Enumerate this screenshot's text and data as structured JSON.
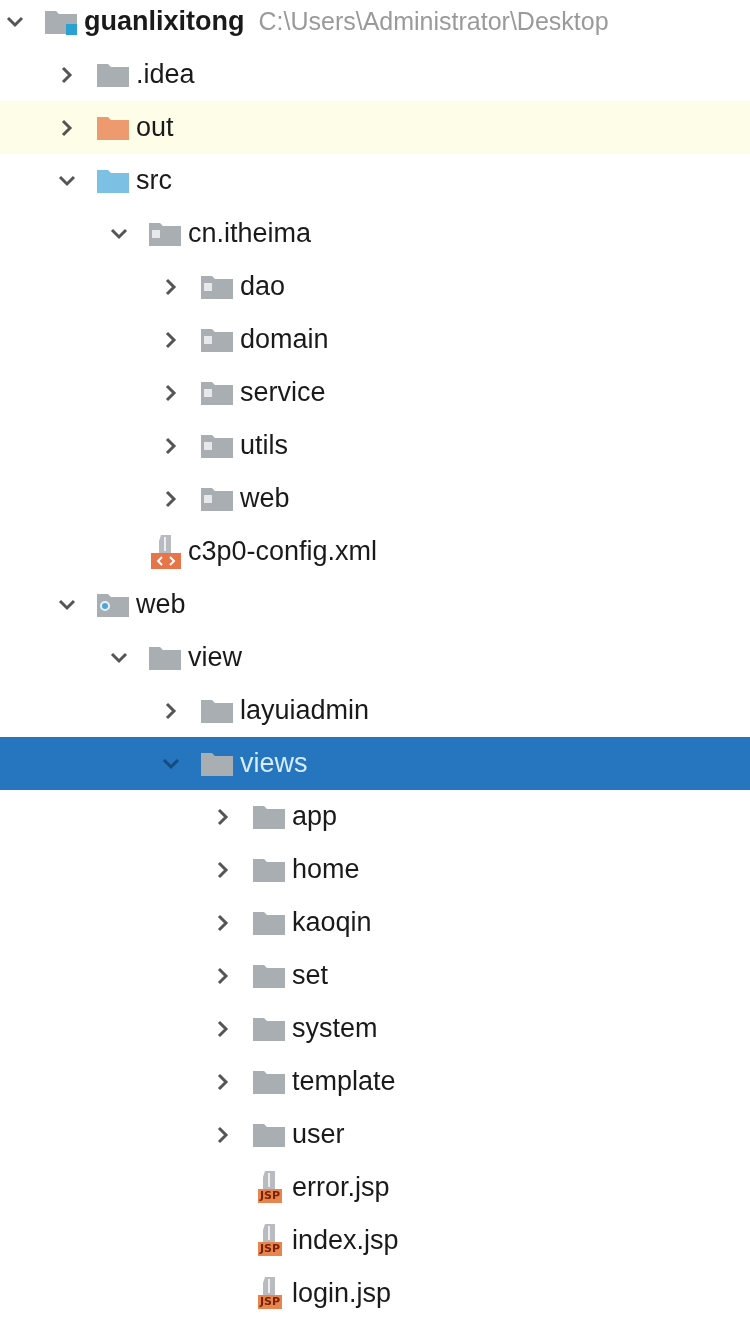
{
  "tree": [
    {
      "kind": "project",
      "label": "guanlixitong",
      "path": "C:\\Users\\Administrator\\Desktop",
      "expanded": true,
      "selected": false,
      "highlighted": false,
      "children": [
        {
          "kind": "folder",
          "label": ".idea",
          "expanded": false,
          "selected": false,
          "highlighted": false
        },
        {
          "kind": "excluded",
          "label": "out",
          "expanded": false,
          "selected": false,
          "highlighted": true
        },
        {
          "kind": "source",
          "label": "src",
          "expanded": true,
          "selected": false,
          "highlighted": false,
          "children": [
            {
              "kind": "package",
              "label": "cn.itheima",
              "expanded": true,
              "selected": false,
              "highlighted": false,
              "children": [
                {
                  "kind": "package",
                  "label": "dao",
                  "expanded": false,
                  "selected": false,
                  "highlighted": false
                },
                {
                  "kind": "package",
                  "label": "domain",
                  "expanded": false,
                  "selected": false,
                  "highlighted": false
                },
                {
                  "kind": "package",
                  "label": "service",
                  "expanded": false,
                  "selected": false,
                  "highlighted": false
                },
                {
                  "kind": "package",
                  "label": "utils",
                  "expanded": false,
                  "selected": false,
                  "highlighted": false
                },
                {
                  "kind": "package",
                  "label": "web",
                  "expanded": false,
                  "selected": false,
                  "highlighted": false
                }
              ]
            },
            {
              "kind": "xml",
              "label": "c3p0-config.xml",
              "selected": false,
              "highlighted": false
            }
          ]
        },
        {
          "kind": "web",
          "label": "web",
          "expanded": true,
          "selected": false,
          "highlighted": false,
          "children": [
            {
              "kind": "folder",
              "label": "view",
              "expanded": true,
              "selected": false,
              "highlighted": false,
              "children": [
                {
                  "kind": "folder",
                  "label": "layuiadmin",
                  "expanded": false,
                  "selected": false,
                  "highlighted": false
                },
                {
                  "kind": "folder",
                  "label": "views",
                  "expanded": true,
                  "selected": true,
                  "highlighted": false,
                  "children": [
                    {
                      "kind": "folder",
                      "label": "app",
                      "expanded": false,
                      "selected": false,
                      "highlighted": false
                    },
                    {
                      "kind": "folder",
                      "label": "home",
                      "expanded": false,
                      "selected": false,
                      "highlighted": false
                    },
                    {
                      "kind": "folder",
                      "label": "kaoqin",
                      "expanded": false,
                      "selected": false,
                      "highlighted": false
                    },
                    {
                      "kind": "folder",
                      "label": "set",
                      "expanded": false,
                      "selected": false,
                      "highlighted": false
                    },
                    {
                      "kind": "folder",
                      "label": "system",
                      "expanded": false,
                      "selected": false,
                      "highlighted": false
                    },
                    {
                      "kind": "folder",
                      "label": "template",
                      "expanded": false,
                      "selected": false,
                      "highlighted": false
                    },
                    {
                      "kind": "folder",
                      "label": "user",
                      "expanded": false,
                      "selected": false,
                      "highlighted": false
                    },
                    {
                      "kind": "jsp",
                      "label": "error.jsp",
                      "badge": "JSP",
                      "selected": false,
                      "highlighted": false
                    },
                    {
                      "kind": "jsp",
                      "label": "index.jsp",
                      "badge": "JSP",
                      "selected": false,
                      "highlighted": false
                    },
                    {
                      "kind": "jsp",
                      "label": "login.jsp",
                      "badge": "JSP",
                      "selected": false,
                      "highlighted": false
                    }
                  ]
                }
              ]
            }
          ]
        }
      ]
    }
  ]
}
